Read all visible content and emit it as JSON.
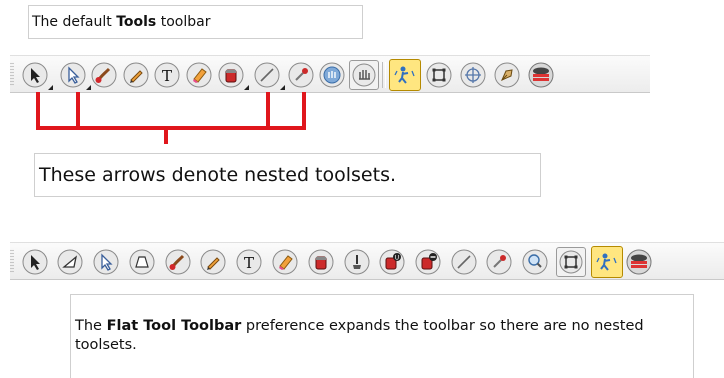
{
  "caption_top": {
    "pre": "The default ",
    "bold": "Tools",
    "post": " toolbar"
  },
  "caption_mid": "These arrows denote nested toolsets.",
  "caption_bottom": {
    "pre": "The ",
    "bold": "Flat Tool Toolbar",
    "post": " preference expands the toolbar so there are no nested toolsets."
  },
  "colors": {
    "bracket": "#e0161c",
    "active_tool": "#ffe680"
  },
  "toolbar_default": [
    "select-tool",
    "contour-editor-tool",
    "brush-tool",
    "pencil-tool",
    "text-tool",
    "eraser-tool",
    "paint-tool",
    "line-tool",
    "dropper-tool",
    "hand-tool",
    "reposition-all-drawings-tool",
    "animate-tool",
    "transform-tool",
    "pivot-tool",
    "stroke-tool",
    "colour-disc-tool"
  ],
  "toolbar_flat": [
    "select-tool",
    "cutter-tool",
    "contour-editor-tool",
    "perspective-tool",
    "brush-tool",
    "pencil-tool",
    "text-tool",
    "eraser-tool",
    "paint-tool",
    "ink-tool",
    "paint-unpainted-tool",
    "paint-unpainted-2-tool",
    "line-tool",
    "dropper-tool",
    "zoom-tool",
    "transform-tool",
    "animate-tool",
    "colour-disc-tool"
  ]
}
